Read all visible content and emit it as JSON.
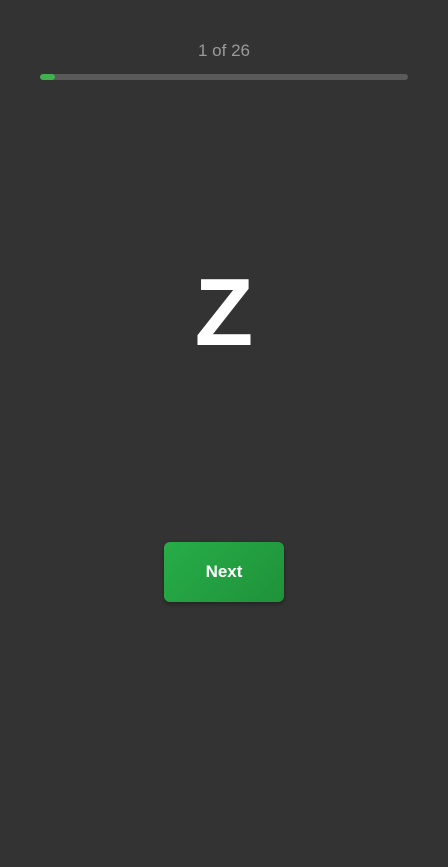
{
  "progress": {
    "counter_text": "1 of 26",
    "current": 1,
    "total": 26,
    "fill_fraction": 0.04,
    "fill_color": "#3fb24f",
    "track_color": "#5a5a5a"
  },
  "card": {
    "letter": "Z"
  },
  "actions": {
    "next_label": "Next",
    "next_color": "#27ad48"
  },
  "theme": {
    "background": "#333333"
  }
}
